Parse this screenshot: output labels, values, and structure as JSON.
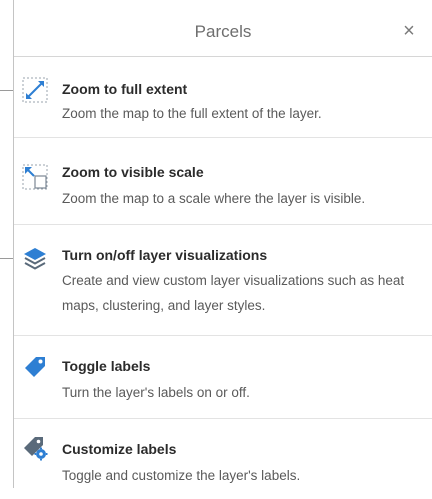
{
  "panel": {
    "title": "Parcels",
    "close_label": "×"
  },
  "items": [
    {
      "title": "Zoom to full extent",
      "desc": "Zoom the map to the full extent of the layer.",
      "icon": "zoom-full-extent-icon"
    },
    {
      "title": "Zoom to visible scale",
      "desc": "Zoom the map to a scale where the layer is visible.",
      "icon": "zoom-visible-scale-icon"
    },
    {
      "title": "Turn on/off layer visualizations",
      "desc": "Create and view custom layer visualizations such as heat maps, clustering, and layer styles.",
      "icon": "layers-icon"
    },
    {
      "title": "Toggle labels",
      "desc": "Turn the layer's labels on or off.",
      "icon": "label-tag-icon"
    },
    {
      "title": "Customize labels",
      "desc": "Toggle and customize the layer's labels.",
      "icon": "label-settings-icon"
    }
  ],
  "colors": {
    "accent": "#2e7fd3",
    "icon_dark": "#5a6a7a"
  }
}
